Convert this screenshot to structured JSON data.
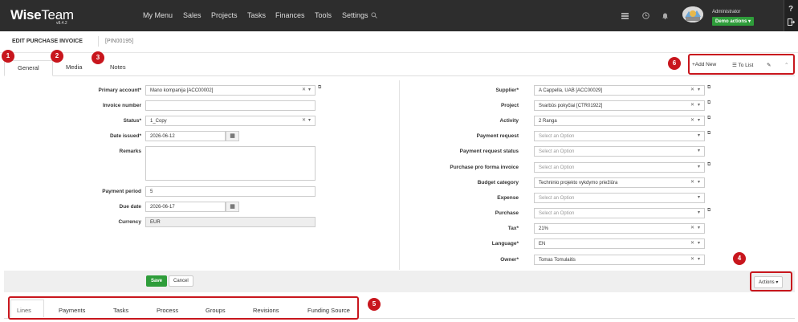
{
  "app": {
    "logo": "Wise",
    "logo_team": "Team",
    "version": "v8.4.2"
  },
  "nav": [
    "My Menu",
    "Sales",
    "Projects",
    "Tasks",
    "Finances",
    "Tools",
    "Settings"
  ],
  "user": {
    "name": "Administrator",
    "demo": "Demo actions ▾"
  },
  "help_icon": "?",
  "page": {
    "title": "EDIT PURCHASE INVOICE",
    "pin": "[PIN00195]"
  },
  "tabs": [
    "General",
    "Media",
    "Notes"
  ],
  "toolbar": {
    "add_new": "Add New",
    "to_list": "To List"
  },
  "badges": [
    "1",
    "2",
    "3",
    "4",
    "5",
    "6"
  ],
  "left_form": {
    "primary_account": {
      "label": "Primary account*",
      "value": "Mano kompanija [ACC00002]"
    },
    "invoice_number": {
      "label": "Invoice number",
      "value": ""
    },
    "status": {
      "label": "Status*",
      "value": "1_Copy"
    },
    "date_issued": {
      "label": "Date issued*",
      "value": "2026-06-12"
    },
    "remarks": {
      "label": "Remarks",
      "value": ""
    },
    "payment_period": {
      "label": "Payment period",
      "value": "5"
    },
    "due_date": {
      "label": "Due date",
      "value": "2026-06-17"
    },
    "currency": {
      "label": "Currency",
      "value": "EUR"
    }
  },
  "right_form": {
    "supplier": {
      "label": "Supplier*",
      "value": "A Cappella, UAB [ACC00029]"
    },
    "project": {
      "label": "Project",
      "value": "Svarbūs pokyčiai [CTR01922]"
    },
    "activity": {
      "label": "Activity",
      "value": "2 Ranga"
    },
    "payment_request": {
      "label": "Payment request",
      "value": "Select an Option"
    },
    "payment_request_status": {
      "label": "Payment request status",
      "value": "Select an Option"
    },
    "pro_forma": {
      "label": "Purchase pro forma invoice",
      "value": "Select an Option"
    },
    "budget_category": {
      "label": "Budget category",
      "value": "Techninio projekto vykdymo priežiūra"
    },
    "expense": {
      "label": "Expense",
      "value": "Select an Option"
    },
    "purchase": {
      "label": "Purchase",
      "value": "Select an Option"
    },
    "tax": {
      "label": "Tax*",
      "value": "21%"
    },
    "language": {
      "label": "Language*",
      "value": "EN"
    },
    "owner": {
      "label": "Owner*",
      "value": "Tomas Tomulaitis"
    }
  },
  "buttons": {
    "save": "Save",
    "cancel": "Cancel",
    "actions": "Actions ▾"
  },
  "bottom_tabs": [
    "Lines",
    "Payments",
    "Tasks",
    "Process",
    "Groups",
    "Revisions",
    "Funding Source"
  ],
  "colors": {
    "accent_green": "#2e9d3a",
    "annotation_red": "#c8161d",
    "topbar": "#2d2d2d"
  }
}
